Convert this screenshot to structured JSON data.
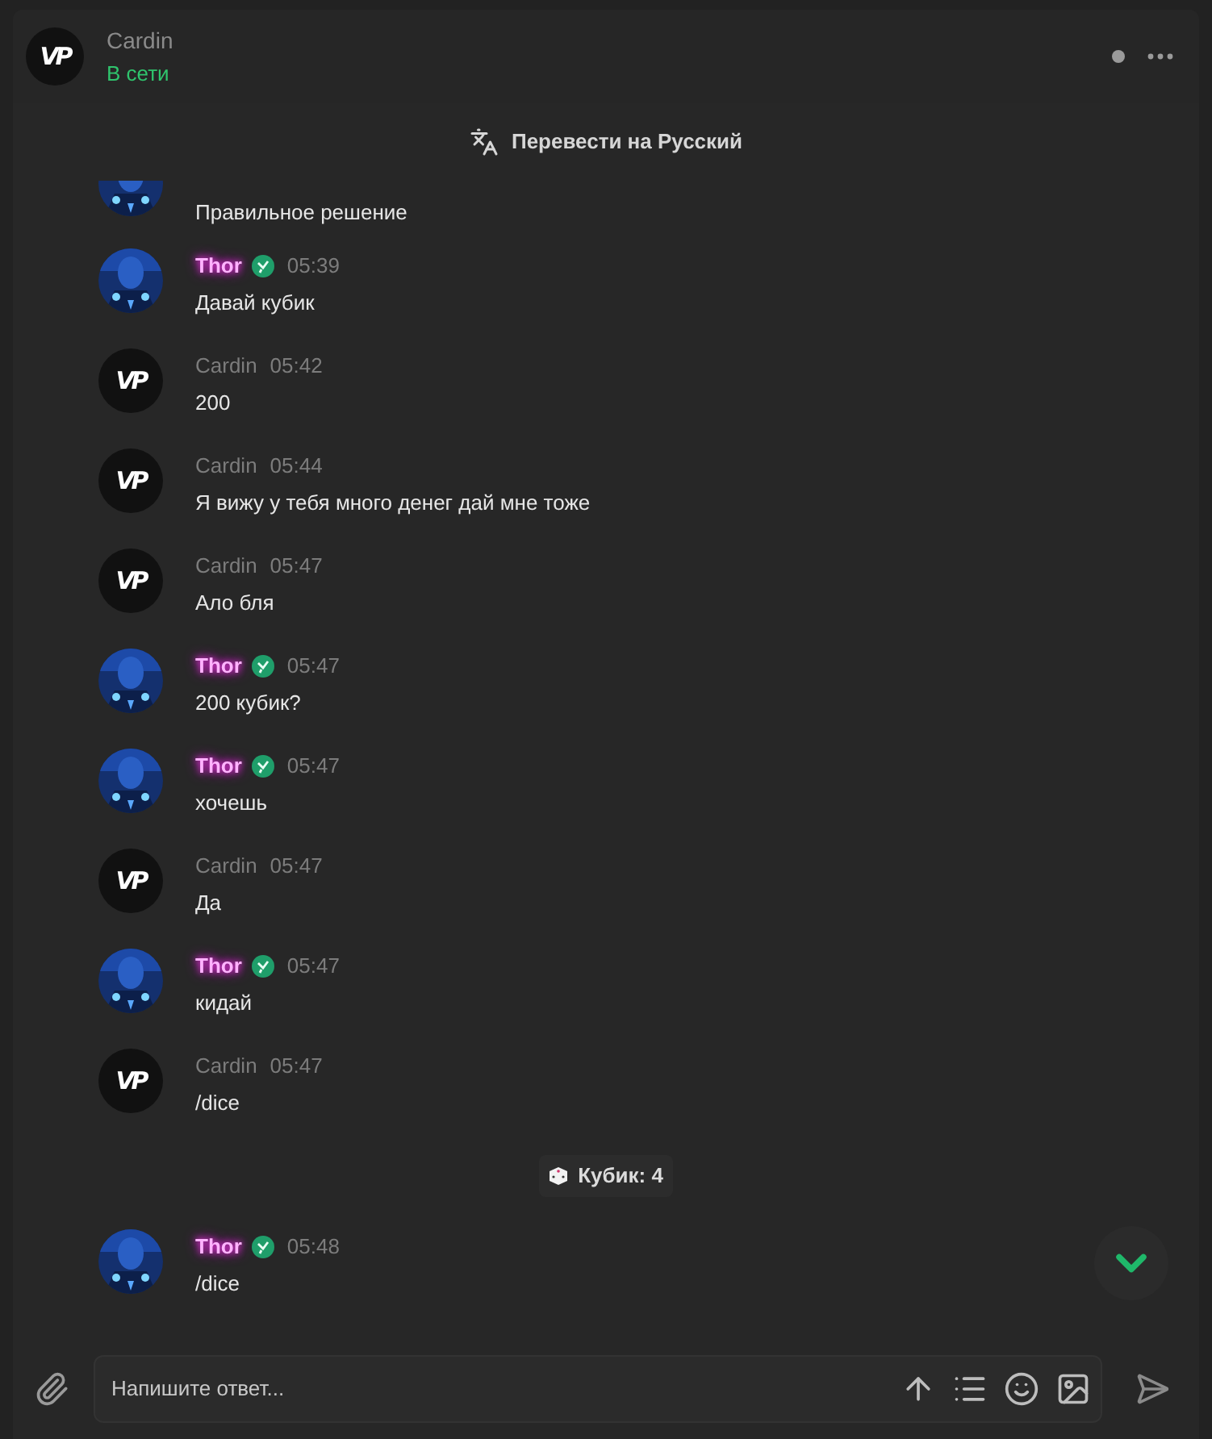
{
  "header": {
    "name": "Cardin",
    "status": "В сети",
    "avatar_label": "VP",
    "online": true
  },
  "translate_bar": {
    "label": "Перевести на Русский"
  },
  "messages": [
    {
      "kind": "thor",
      "text": "Правильное решение",
      "partial": true
    },
    {
      "kind": "thor",
      "author": "Thor",
      "time": "05:39",
      "text": "Давай кубик"
    },
    {
      "kind": "cardin",
      "author": "Cardin",
      "avatar_label": "VP",
      "time": "05:42",
      "text": "200"
    },
    {
      "kind": "cardin",
      "author": "Cardin",
      "avatar_label": "VP",
      "time": "05:44",
      "text": "Я вижу у тебя много денег дай мне тоже"
    },
    {
      "kind": "cardin",
      "author": "Cardin",
      "avatar_label": "VP",
      "time": "05:47",
      "text": "Ало бля"
    },
    {
      "kind": "thor",
      "author": "Thor",
      "time": "05:47",
      "text": "200 кубик?"
    },
    {
      "kind": "thor",
      "author": "Thor",
      "time": "05:47",
      "text": "хочешь"
    },
    {
      "kind": "cardin",
      "author": "Cardin",
      "avatar_label": "VP",
      "time": "05:47",
      "text": "Да"
    },
    {
      "kind": "thor",
      "author": "Thor",
      "time": "05:47",
      "text": "кидай"
    },
    {
      "kind": "cardin",
      "author": "Cardin",
      "avatar_label": "VP",
      "time": "05:47",
      "text": "/dice"
    },
    {
      "kind": "service",
      "text": "Кубик: 4"
    },
    {
      "kind": "thor",
      "author": "Thor",
      "time": "05:48",
      "text": "/dice"
    }
  ],
  "composer": {
    "placeholder": "Напишите ответ..."
  }
}
